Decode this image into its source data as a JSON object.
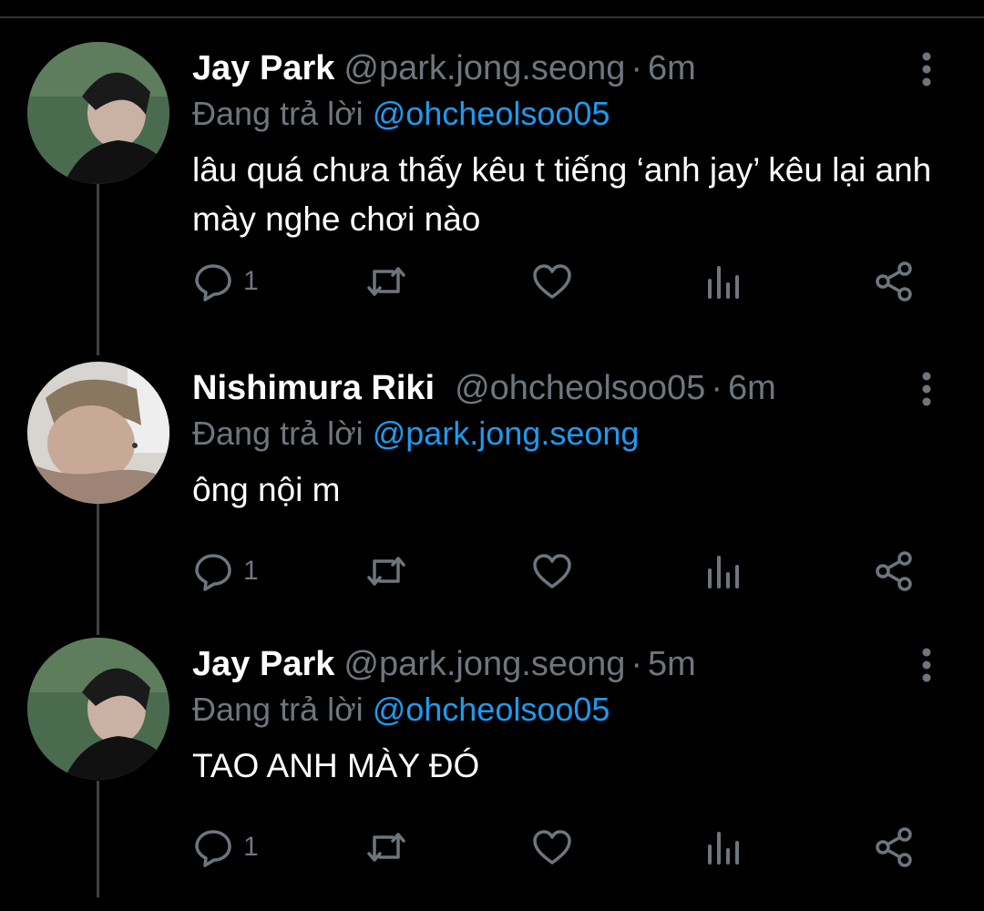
{
  "colors": {
    "background": "#000000",
    "name": "#ffffff",
    "muted": "#6e767d",
    "mention": "#1d9bf0",
    "text": "#ffffff"
  },
  "tweets": [
    {
      "name": "Jay Park",
      "handle": "@park.jong.seong",
      "separator": "·",
      "time": "6m",
      "replying_prefix": "Đang trả lời",
      "replying_to": "@ohcheolsoo05",
      "text": "lâu quá chưa thấy kêu t tiếng ‘anh jay’ kêu lại anh mày nghe chơi nào",
      "reply_count": "1",
      "icons": [
        "reply-icon",
        "retweet-icon",
        "like-icon",
        "analytics-icon",
        "share-icon",
        "more-icon"
      ]
    },
    {
      "name": "Nishimura Riki",
      "handle": "@ohcheolsoo05",
      "separator": "·",
      "time": "6m",
      "replying_prefix": "Đang trả lời",
      "replying_to": "@park.jong.seong",
      "text": "ông nội m",
      "reply_count": "1",
      "icons": [
        "reply-icon",
        "retweet-icon",
        "like-icon",
        "analytics-icon",
        "share-icon",
        "more-icon"
      ]
    },
    {
      "name": "Jay Park",
      "handle": "@park.jong.seong",
      "separator": "·",
      "time": "5m",
      "replying_prefix": "Đang trả lời",
      "replying_to": "@ohcheolsoo05",
      "text": "TAO ANH MÀY ĐÓ",
      "reply_count": "1",
      "icons": [
        "reply-icon",
        "retweet-icon",
        "like-icon",
        "analytics-icon",
        "share-icon",
        "more-icon"
      ]
    }
  ]
}
